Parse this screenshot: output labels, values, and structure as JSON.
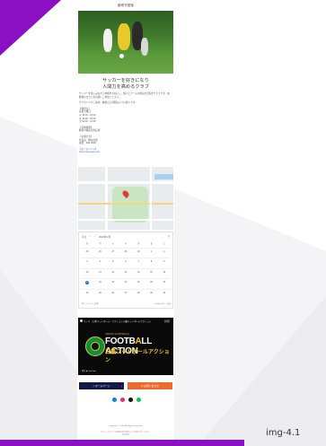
{
  "site": {
    "title": "鶴巻学習塾"
  },
  "headline": {
    "line1": "サッカーを好きになり",
    "line2": "人間力を高めるクラブ"
  },
  "body": {
    "intro": "サッカーを楽しみながら仲間を大切にし、個人とチームの成長を目指すクラブです。未経験の方でもお気軽にご参加ください。",
    "practice_label": "グラウンドのご案内：練習日と時間は以下の通りです。",
    "schedule_title": "【練習日】",
    "schedule_lines": [
      "毎週土曜日",
      "火 16:00 - 18:00",
      "木 16:00 - 18:00",
      "土 09:00 - 12:00"
    ],
    "place_title": "【活動場所】",
    "place_line": "鶴巻公園多目的広場",
    "contact_title": "【お問合せ】",
    "contact_lines": [
      "代表者：鶴巻太郎",
      "電話：000-0000"
    ],
    "homepage_title": "【ホームページ】",
    "homepage_url": "https://example.com"
  },
  "calendar": {
    "today_button": "今日",
    "month_label": "2024年 3月",
    "weekdays": [
      "日",
      "月",
      "火",
      "水",
      "木",
      "金",
      "土"
    ],
    "days": [
      "25",
      "26",
      "27",
      "28",
      "29",
      "1",
      "2",
      "3",
      "4",
      "5",
      "6",
      "7",
      "8",
      "9",
      "10",
      "11",
      "12",
      "13",
      "14",
      "15",
      "16",
      "17",
      "18",
      "19",
      "20",
      "21",
      "22",
      "23",
      "24",
      "25",
      "26",
      "27",
      "28",
      "29",
      "30"
    ],
    "today_index": 21,
    "timezone": "タイムゾーン: 日本",
    "brand": "Google カレンダー"
  },
  "video": {
    "title": "ラーマ ｜日本フットボール・アクション 日豪フットボールアクション",
    "small_head": "JAPAN×AUSTRALIA",
    "big_title_a": "FOOTB",
    "big_title_accent": "A",
    "big_title_b": "LL ACTION",
    "jp_title": "日豪フットボールアクション",
    "platform": "再生 ▶ YouTube",
    "share": "共有"
  },
  "buttons": {
    "home": "ホームページ",
    "contact": "お問い合わせ"
  },
  "footer": {
    "copyright": "Copyright © 2024 All Rights Reserved.",
    "note1": "当サイトのすべての情報は著作権法により保護されています。",
    "note2": "利用規約"
  },
  "label": "img-4.1",
  "colors": {
    "accent_purple": "#8b0fc4",
    "home_button": "#12194a",
    "contact_button": "#ec6a2c",
    "grass": "#5a9a3a"
  }
}
